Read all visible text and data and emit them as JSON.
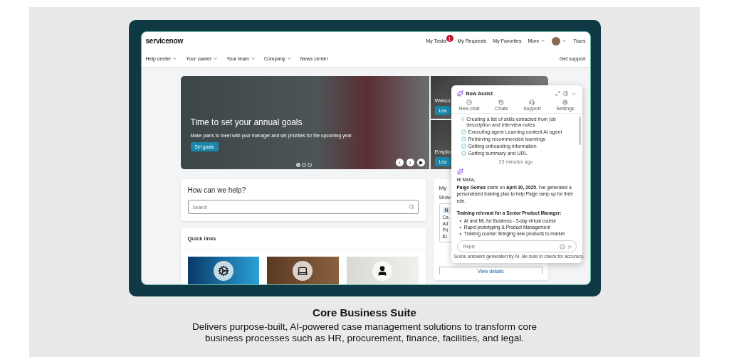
{
  "header": {
    "logo": "servicenow",
    "links": [
      {
        "kind": "link",
        "label": "My Tasks",
        "badge": "1"
      },
      {
        "kind": "link",
        "label": "My Requests"
      },
      {
        "kind": "link",
        "label": "My Favorites"
      },
      {
        "kind": "menu",
        "label": "More"
      },
      {
        "kind": "avatar"
      },
      {
        "kind": "link",
        "label": "Tours"
      }
    ]
  },
  "nav": {
    "items": [
      {
        "label": "Help center",
        "dropdown": true
      },
      {
        "label": "Your career",
        "dropdown": true
      },
      {
        "label": "Your team",
        "dropdown": true
      },
      {
        "label": "Company",
        "dropdown": true
      },
      {
        "label": "News center",
        "dropdown": false
      }
    ],
    "support": "Get support"
  },
  "hero": {
    "title": "Time to set your annual goals",
    "subtitle": "Make plans to meet with your manager and set priorities for the upcoming year.",
    "button": "Set goals",
    "dots": [
      {
        "selected": true
      },
      {
        "selected": false
      },
      {
        "selected": false
      }
    ],
    "side_cards": [
      {
        "title": "Welco",
        "button": "Lea"
      },
      {
        "title": "Emplo",
        "button": "Lea"
      }
    ]
  },
  "help": {
    "title": "How can we help?",
    "search": {
      "placeholder": "Search"
    }
  },
  "quick_links": {
    "title": "Quick links",
    "tiles": [
      {
        "kind": "gears"
      },
      {
        "kind": "laptop"
      },
      {
        "kind": "person"
      }
    ]
  },
  "my_card": {
    "title": "My",
    "show": "Show",
    "item": {
      "tag": "N",
      "name": "Ca",
      "line": "Ad",
      "label": "Pri",
      "price": "$1"
    },
    "button": "View details"
  },
  "assistant": {
    "title": "Now Assist",
    "tabs": [
      {
        "kind": "new",
        "label": "New chat"
      },
      {
        "kind": "chats",
        "label": "Chats"
      },
      {
        "kind": "support",
        "label": "Support"
      },
      {
        "kind": "settings",
        "label": "Settings"
      }
    ],
    "steps": [
      {
        "text": "Creating a list of skills extracted from job description and interview notes",
        "done": true
      },
      {
        "text": "Executing agent Learning content AI agent",
        "done": true
      },
      {
        "text": "Retrieving recommended learnings",
        "done": true
      },
      {
        "text": "Getting onboarding information",
        "done": true
      },
      {
        "text": "Getting summary and URL",
        "done": true
      }
    ],
    "time": "23 minutes ago",
    "greeting": "Hi Maria,",
    "message": "**Paige Gomez** starts on **April 30, 2025**. I've generated a personalized training plan to help Paige ramp up for their role.",
    "list_title": "Training relevant for a Senior Product Manager:",
    "bullet": "•",
    "bullets": [
      "AI and ML for Business - 3-day virtual course",
      "Rapid prototyping & Product Management",
      "Training course: Bringing new products to market"
    ],
    "reply": {
      "placeholder": "Reply"
    },
    "disclaimer": "Some answers generated by AI. Be sure to check for accuracy."
  },
  "caption": {
    "title": "Core Business Suite",
    "text": "Delivers purpose-built, AI-powered case management solutions to transform core business processes such as HR, procurement, finance, facilities, and legal."
  }
}
